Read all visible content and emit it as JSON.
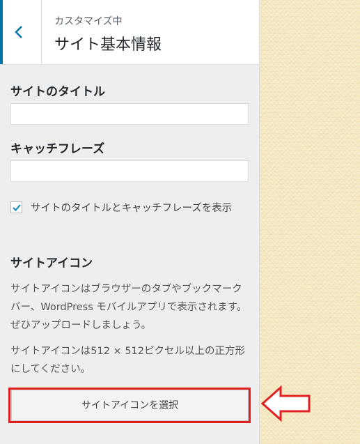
{
  "header": {
    "back_icon": "chevron-left-icon",
    "subtitle": "カスタマイズ中",
    "title": "サイト基本情報"
  },
  "site_title": {
    "label": "サイトのタイトル",
    "value": ""
  },
  "tagline": {
    "label": "キャッチフレーズ",
    "value": ""
  },
  "display_checkbox": {
    "checked": true,
    "label": "サイトのタイトルとキャッチフレーズを表示"
  },
  "site_icon": {
    "heading": "サイトアイコン",
    "description": "サイトアイコンはブラウザーのタブやブックマークバー、WordPress モバイルアプリで表示されます。ぜひアップロードしましょう。",
    "size_note": "サイトアイコンは512 × 512ピクセル以上の正方形にしてください。",
    "select_button": "サイトアイコンを選択"
  },
  "annotation": {
    "highlight_color": "#e02020",
    "arrow_icon": "arrow-left-icon"
  },
  "colors": {
    "accent": "#0073aa",
    "panel_bg": "#eeeeee",
    "preview_bg": "#f6eac4"
  }
}
